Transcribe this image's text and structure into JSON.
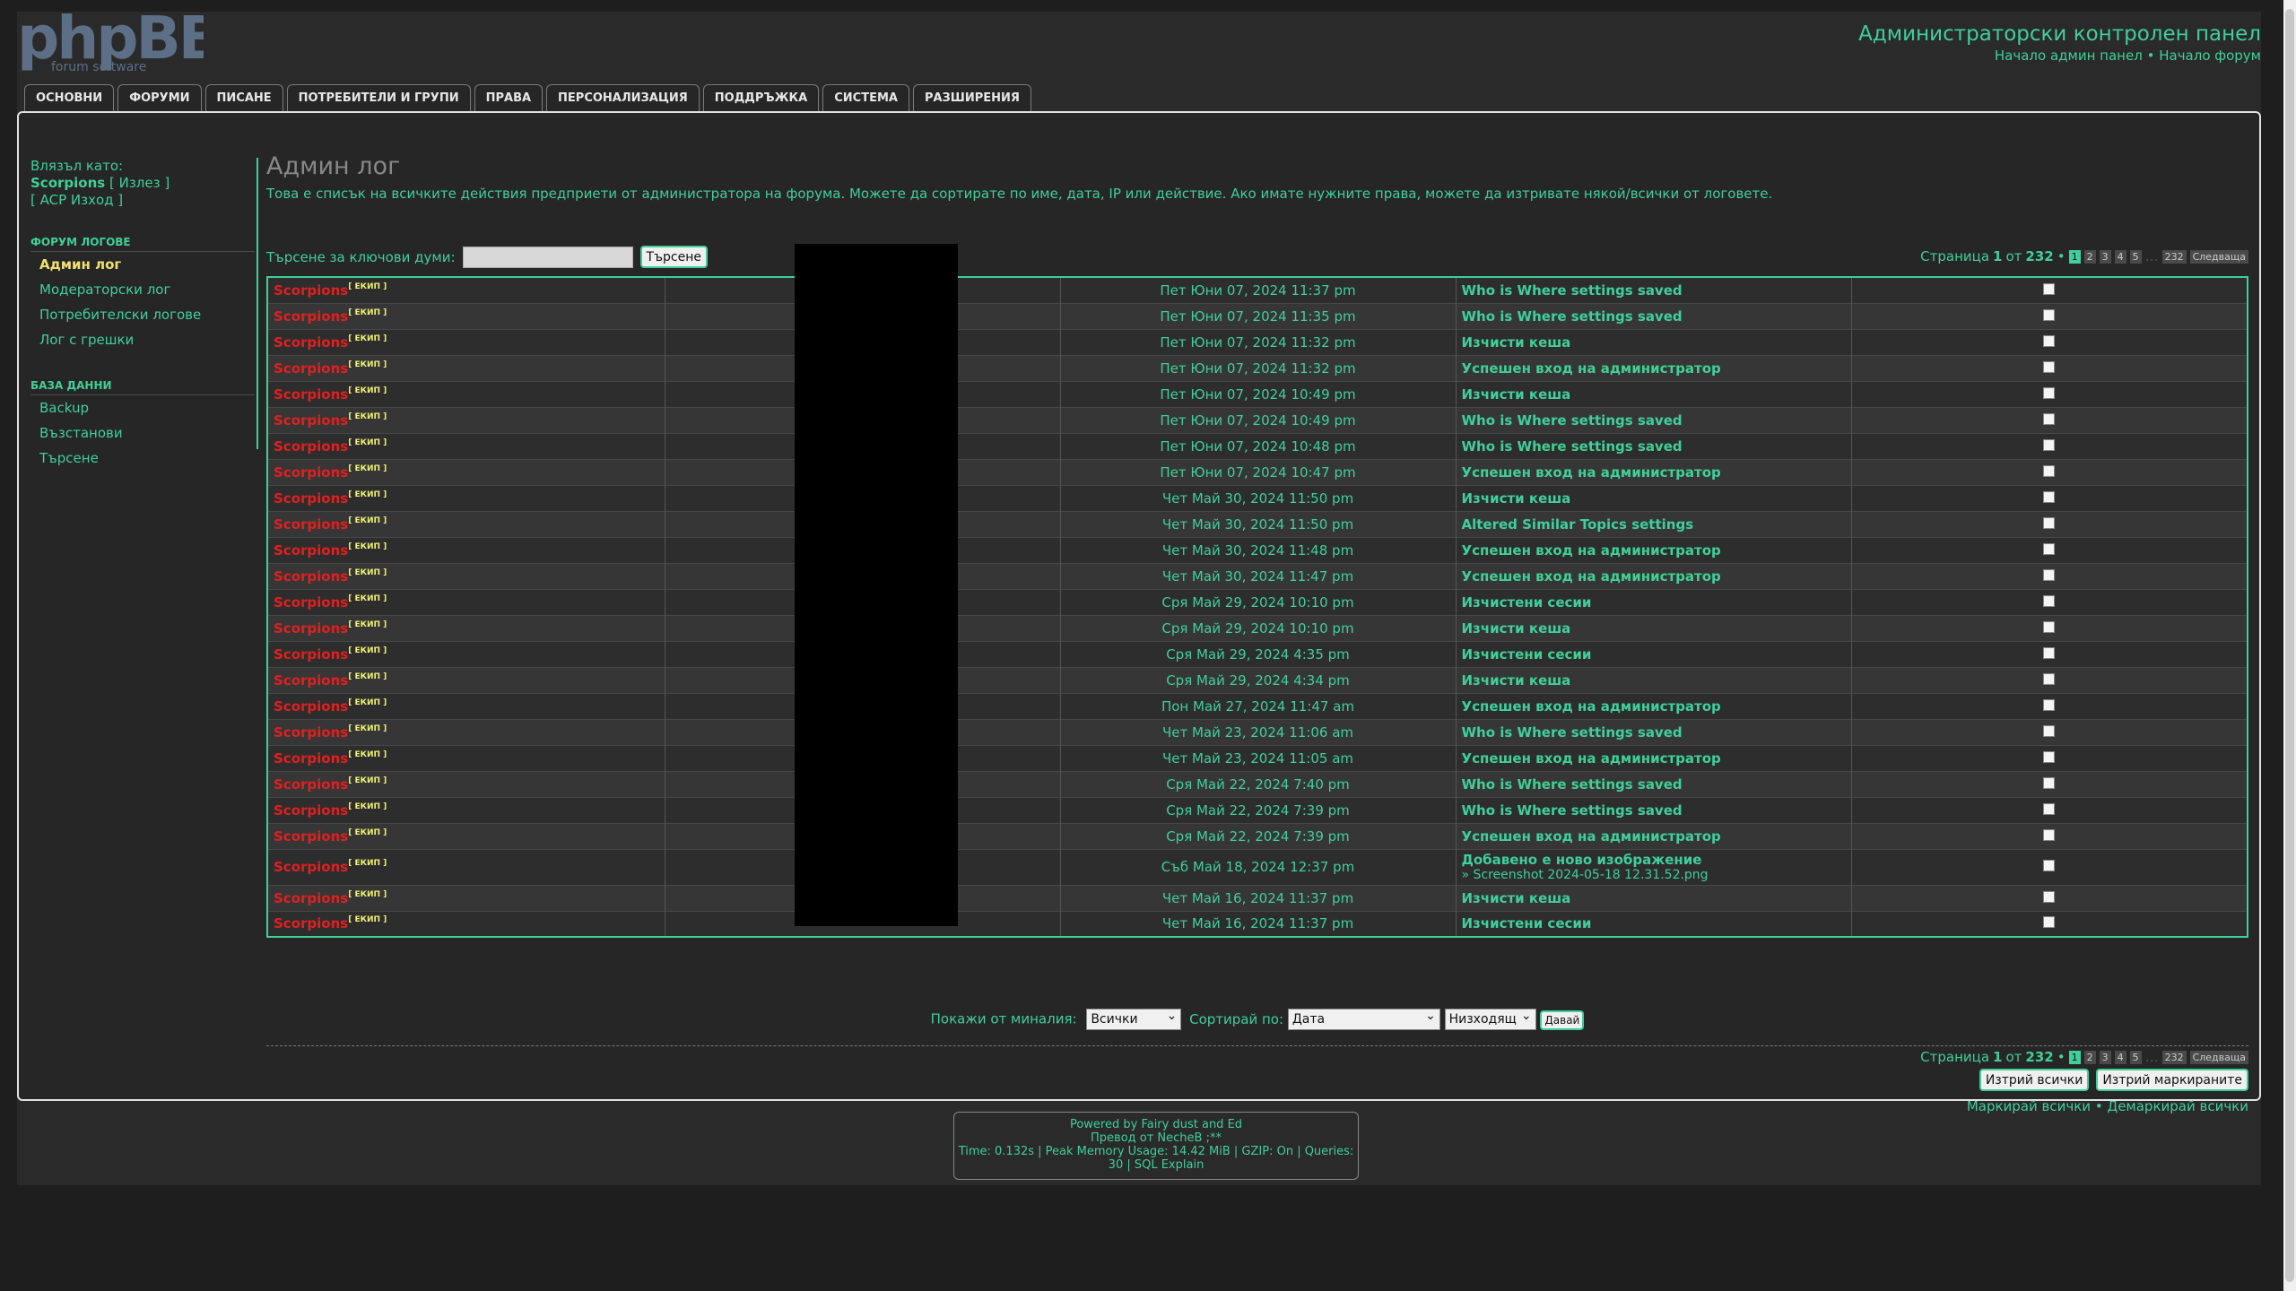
{
  "logo": {
    "main": "phpBB",
    "sub": "forum  software"
  },
  "header": {
    "title": "Администраторски контролен панел",
    "link_admin": "Начало админ панел",
    "sep": "•",
    "link_forum": "Начало форум"
  },
  "tabs": [
    "ОСНОВНИ",
    "ФОРУМИ",
    "ПИСАНЕ",
    "ПОТРЕБИТЕЛИ И ГРУПИ",
    "ПРАВА",
    "ПЕРСОНАЛИЗАЦИЯ",
    "ПОДДРЪЖКА",
    "СИСТЕМА",
    "РАЗШИРЕНИЯ"
  ],
  "sidebar": {
    "logged_as": "Влязъл като:",
    "user": "Scorpions",
    "logout": "[ Излез ]",
    "acp_logout": "[ ACP Изход ]",
    "sections": [
      {
        "title": "ФОРУМ ЛОГОВЕ",
        "items": [
          "Админ лог",
          "Модераторски лог",
          "Потребителски логове",
          "Лог с грешки"
        ]
      },
      {
        "title": "БАЗА ДАННИ",
        "items": [
          "Backup",
          "Възстанови",
          "Търсене"
        ]
      }
    ]
  },
  "main": {
    "title": "Админ лог",
    "description": "Това е списък на всичките действия предприети от администратора на форума. Можете да сортирате по име, дата, IP или действие. Ако имате нужните права, можете да изтривате някой/всички от логовете.",
    "search_label": "Търсене за ключови думи:",
    "search_button": "Търсене"
  },
  "pagination": {
    "label": "Страница",
    "current": "1",
    "of": "от",
    "total": "232",
    "pages": [
      "1",
      "2",
      "3",
      "4",
      "5"
    ],
    "ellipsis": "…",
    "last": "232",
    "next": "Следваща"
  },
  "log_rows": [
    {
      "user": "Scorpions",
      "exp": "[ ЕКИП ]",
      "date": "Пет Юни 07, 2024 11:37 pm",
      "action": "Who is Where settings saved"
    },
    {
      "user": "Scorpions",
      "exp": "[ ЕКИП ]",
      "date": "Пет Юни 07, 2024 11:35 pm",
      "action": "Who is Where settings saved"
    },
    {
      "user": "Scorpions",
      "exp": "[ ЕКИП ]",
      "date": "Пет Юни 07, 2024 11:32 pm",
      "action": "Изчисти кеша"
    },
    {
      "user": "Scorpions",
      "exp": "[ ЕКИП ]",
      "date": "Пет Юни 07, 2024 11:32 pm",
      "action": "Успешен вход на администратор"
    },
    {
      "user": "Scorpions",
      "exp": "[ ЕКИП ]",
      "date": "Пет Юни 07, 2024 10:49 pm",
      "action": "Изчисти кеша"
    },
    {
      "user": "Scorpions",
      "exp": "[ ЕКИП ]",
      "date": "Пет Юни 07, 2024 10:49 pm",
      "action": "Who is Where settings saved"
    },
    {
      "user": "Scorpions",
      "exp": "[ ЕКИП ]",
      "date": "Пет Юни 07, 2024 10:48 pm",
      "action": "Who is Where settings saved"
    },
    {
      "user": "Scorpions",
      "exp": "[ ЕКИП ]",
      "date": "Пет Юни 07, 2024 10:47 pm",
      "action": "Успешен вход на администратор"
    },
    {
      "user": "Scorpions",
      "exp": "[ ЕКИП ]",
      "date": "Чет Май 30, 2024 11:50 pm",
      "action": "Изчисти кеша"
    },
    {
      "user": "Scorpions",
      "exp": "[ ЕКИП ]",
      "date": "Чет Май 30, 2024 11:50 pm",
      "action": "Altered Similar Topics settings"
    },
    {
      "user": "Scorpions",
      "exp": "[ ЕКИП ]",
      "date": "Чет Май 30, 2024 11:48 pm",
      "action": "Успешен вход на администратор"
    },
    {
      "user": "Scorpions",
      "exp": "[ ЕКИП ]",
      "date": "Чет Май 30, 2024 11:47 pm",
      "action": "Успешен вход на администратор"
    },
    {
      "user": "Scorpions",
      "exp": "[ ЕКИП ]",
      "date": "Сря Май 29, 2024 10:10 pm",
      "action": "Изчистени сесии"
    },
    {
      "user": "Scorpions",
      "exp": "[ ЕКИП ]",
      "date": "Сря Май 29, 2024 10:10 pm",
      "action": "Изчисти кеша"
    },
    {
      "user": "Scorpions",
      "exp": "[ ЕКИП ]",
      "date": "Сря Май 29, 2024 4:35 pm",
      "action": "Изчистени сесии"
    },
    {
      "user": "Scorpions",
      "exp": "[ ЕКИП ]",
      "date": "Сря Май 29, 2024 4:34 pm",
      "action": "Изчисти кеша"
    },
    {
      "user": "Scorpions",
      "exp": "[ ЕКИП ]",
      "date": "Пон Май 27, 2024 11:47 am",
      "action": "Успешен вход на администратор"
    },
    {
      "user": "Scorpions",
      "exp": "[ ЕКИП ]",
      "date": "Чет Май 23, 2024 11:06 am",
      "action": "Who is Where settings saved"
    },
    {
      "user": "Scorpions",
      "exp": "[ ЕКИП ]",
      "date": "Чет Май 23, 2024 11:05 am",
      "action": "Успешен вход на администратор"
    },
    {
      "user": "Scorpions",
      "exp": "[ ЕКИП ]",
      "date": "Сря Май 22, 2024 7:40 pm",
      "action": "Who is Where settings saved"
    },
    {
      "user": "Scorpions",
      "exp": "[ ЕКИП ]",
      "date": "Сря Май 22, 2024 7:39 pm",
      "action": "Who is Where settings saved"
    },
    {
      "user": "Scorpions",
      "exp": "[ ЕКИП ]",
      "date": "Сря Май 22, 2024 7:39 pm",
      "action": "Успешен вход на администратор"
    },
    {
      "user": "Scorpions",
      "exp": "[ ЕКИП ]",
      "date": "Съб Май 18, 2024 12:37 pm",
      "action": "Добавено е ново изображение",
      "sub": "» Screenshot 2024-05-18 12.31.52.png"
    },
    {
      "user": "Scorpions",
      "exp": "[ ЕКИП ]",
      "date": "Чет Май 16, 2024 11:37 pm",
      "action": "Изчисти кеша"
    },
    {
      "user": "Scorpions",
      "exp": "[ ЕКИП ]",
      "date": "Чет Май 16, 2024 11:37 pm",
      "action": "Изчистени сесии"
    }
  ],
  "filters": {
    "show_label": "Покажи от миналия:",
    "show_value": "Всички",
    "sort_label": "Сортирай по:",
    "sort_value": "Дата",
    "order_value": "Низходящ",
    "go": "Давай"
  },
  "bulk": {
    "delete_all": "Изтрий всички",
    "delete_marked": "Изтрий маркираните",
    "mark_all": "Маркирай всички",
    "sep": "•",
    "unmark_all": "Демаркирай всички"
  },
  "footer": {
    "line1": "Powered by Fairy dust and Ed",
    "line2": "Превод от NecheB ;**",
    "line3": "Time: 0.132s | Peak Memory Usage: 14.42 MiB | GZIP: On | Queries:",
    "line4": "30 | SQL Explain"
  }
}
